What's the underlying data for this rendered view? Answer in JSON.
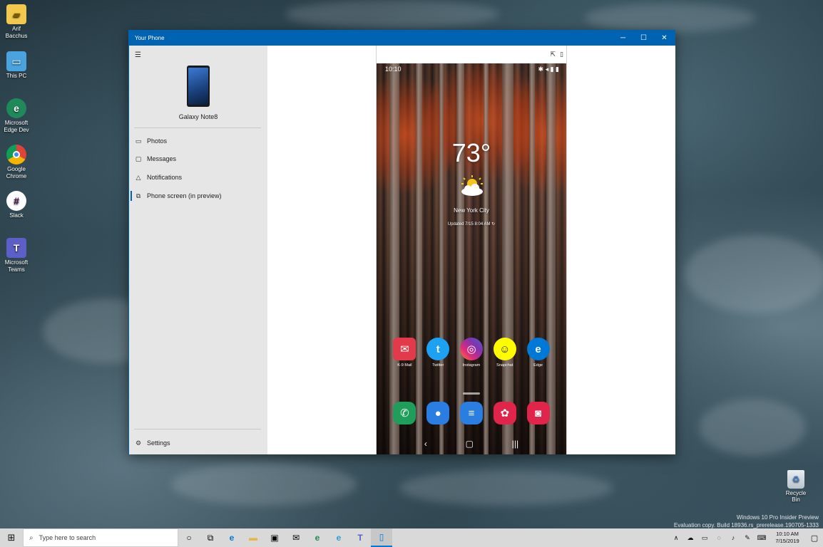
{
  "desktop": {
    "icons": [
      {
        "label": "Arif Bacchus",
        "icon": "user-folder-icon",
        "color": "#f2c94c"
      },
      {
        "label": "This PC",
        "icon": "computer-icon",
        "color": "#4aa3df"
      },
      {
        "label": "Microsoft Edge Dev",
        "icon": "edge-dev-icon",
        "color": "#1e8a5a"
      },
      {
        "label": "Google Chrome",
        "icon": "chrome-icon",
        "color": "#db4437"
      },
      {
        "label": "Slack",
        "icon": "slack-icon",
        "color": "#ffffff"
      },
      {
        "label": "Microsoft Teams",
        "icon": "teams-icon",
        "color": "#5b5fc7"
      }
    ],
    "recycle_bin_label": "Recycle Bin",
    "watermark_line1": "Windows 10 Pro Insider Preview",
    "watermark_line2": "Evaluation copy. Build 18936.rs_prerelease.190705-1333"
  },
  "window": {
    "title": "Your Phone",
    "minimize_glyph": "─",
    "maximize_glyph": "☐",
    "close_glyph": "✕",
    "sidebar": {
      "device_name": "Galaxy Note8",
      "nav": [
        {
          "label": "Photos",
          "icon": "photos-icon",
          "glyph": "▭"
        },
        {
          "label": "Messages",
          "icon": "messages-icon",
          "glyph": "▢"
        },
        {
          "label": "Notifications",
          "icon": "bell-icon",
          "glyph": "△"
        },
        {
          "label": "Phone screen (in preview)",
          "icon": "phone-screen-icon",
          "glyph": "⧉"
        }
      ],
      "settings_label": "Settings",
      "settings_glyph": "⚙"
    },
    "phone_toolbar": {
      "pin_glyph": "⇱",
      "settings_glyph": "▯"
    },
    "phone": {
      "status_time": "10:10",
      "status_icons": "✱ ◂ ▮ ▮",
      "temperature": "73°",
      "city": "New York City",
      "updated": "Updated 7/15 8:04 AM ↻",
      "apps_row1": [
        {
          "label": "K-9 Mail",
          "color": "#e23a4a",
          "glyph": "✉"
        },
        {
          "label": "Twitter",
          "color": "#1da1f2",
          "glyph": "t"
        },
        {
          "label": "Instagram",
          "color": "#c13584",
          "glyph": "◎"
        },
        {
          "label": "Snapchat",
          "color": "#fffc00",
          "glyph": "☺"
        },
        {
          "label": "Edge",
          "color": "#0078d7",
          "glyph": "e"
        }
      ],
      "dock": [
        {
          "name": "phone",
          "color": "#1e9e5a",
          "glyph": "✆"
        },
        {
          "name": "contacts",
          "color": "#2a7de1",
          "glyph": "●"
        },
        {
          "name": "messages",
          "color": "#2a7de1",
          "glyph": "≡"
        },
        {
          "name": "bixby",
          "color": "#e0244a",
          "glyph": "✿"
        },
        {
          "name": "camera",
          "color": "#e0244a",
          "glyph": "◙"
        }
      ],
      "nav_back": "‹",
      "nav_home": "▢",
      "nav_recent": "|||"
    }
  },
  "taskbar": {
    "start_glyph": "⊞",
    "search_placeholder": "Type here to search",
    "search_glyph": "⌕",
    "items": [
      {
        "name": "cortana",
        "glyph": "○"
      },
      {
        "name": "task-view",
        "glyph": "⧉"
      },
      {
        "name": "edge",
        "glyph": "e"
      },
      {
        "name": "file-explorer",
        "glyph": "▬"
      },
      {
        "name": "store",
        "glyph": "▣"
      },
      {
        "name": "mail",
        "glyph": "✉"
      },
      {
        "name": "edge-dev",
        "glyph": "e"
      },
      {
        "name": "edge-beta",
        "glyph": "e"
      },
      {
        "name": "teams",
        "glyph": "T"
      },
      {
        "name": "your-phone",
        "glyph": "▯"
      }
    ],
    "tray_glyphs": [
      "∧",
      "☁",
      "▭",
      "◌",
      "♪",
      "✎",
      "⌨"
    ],
    "time": "10:10 AM",
    "date": "7/15/2019",
    "notifications_glyph": "▢"
  }
}
